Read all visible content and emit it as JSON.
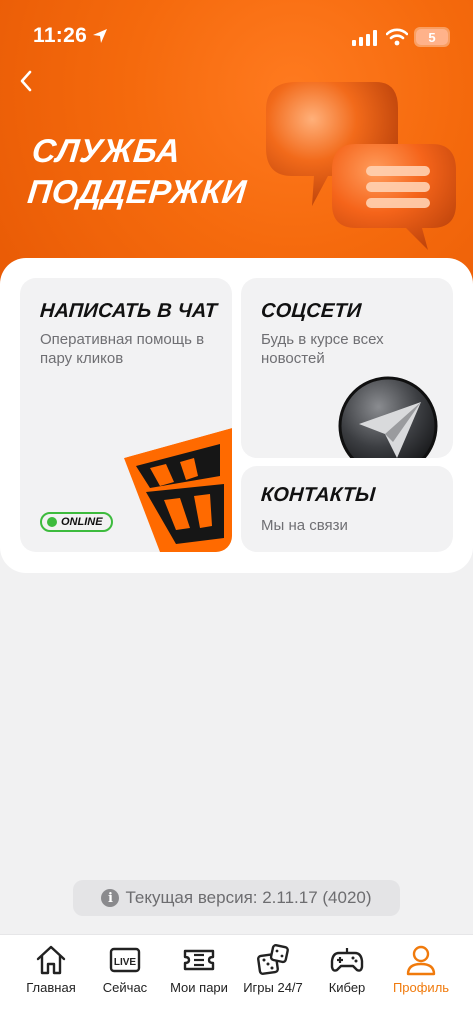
{
  "status_bar": {
    "time": "11:26",
    "battery": "5"
  },
  "header": {
    "title": "СЛУЖБА ПОДДЕРЖКИ",
    "back_icon": "chevron-left-icon",
    "illustration": "chat-bubbles-icon"
  },
  "cards": {
    "chat": {
      "title": "НАПИСАТЬ В ЧАТ",
      "subtitle": "Оперативная помощь в пару кликов",
      "badge": "ONLINE"
    },
    "social": {
      "title": "СОЦСЕТИ",
      "subtitle": "Будь в курсе всех новостей",
      "icon": "telegram-icon"
    },
    "contacts": {
      "title": "КОНТАКТЫ",
      "subtitle": "Мы на связи"
    }
  },
  "version": {
    "text": "Текущая версия: 2.11.17 (4020)",
    "icon_letter": "i"
  },
  "tabbar": {
    "tabs": [
      {
        "label": "Главная",
        "icon": "home-icon"
      },
      {
        "label": "Сейчас",
        "icon": "live-icon"
      },
      {
        "label": "Мои пари",
        "icon": "ticket-icon"
      },
      {
        "label": "Игры 24/7",
        "icon": "dice-icon"
      },
      {
        "label": "Кибер",
        "icon": "gamepad-icon"
      },
      {
        "label": "Профиль",
        "icon": "profile-icon"
      }
    ],
    "active_index": 5
  },
  "colors": {
    "accent": "#f07a0c",
    "hero_orange": "#f56a0d",
    "online_green": "#3dbb3d"
  }
}
